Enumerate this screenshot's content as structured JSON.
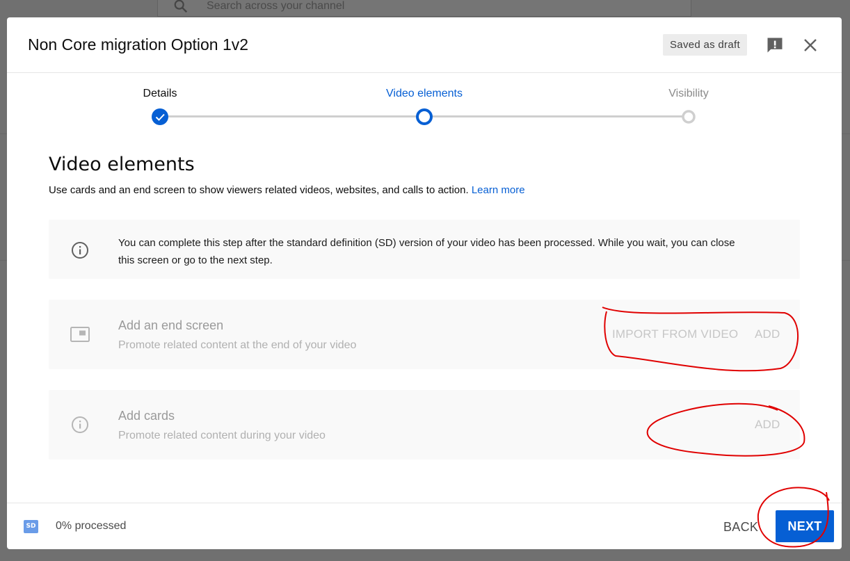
{
  "background": {
    "search_placeholder": "Search across your channel",
    "search_icon": "search-icon"
  },
  "dialog": {
    "title": "Non Core migration Option 1v2",
    "draft_badge": "Saved as draft",
    "feedback_icon": "feedback-icon",
    "close_icon": "close-icon"
  },
  "stepper": {
    "steps": [
      {
        "label": "Details",
        "state": "done"
      },
      {
        "label": "Video elements",
        "state": "active"
      },
      {
        "label": "Visibility",
        "state": "todo"
      }
    ],
    "active_color": "#065fd4"
  },
  "content": {
    "title": "Video elements",
    "description": "Use cards and an end screen to show viewers related videos, websites, and calls to action.",
    "learn_more": "Learn more",
    "info_message": "You can complete this step after the standard definition (SD) version of your video has been processed. While you wait, you can close this screen or go to the next step.",
    "end_screen": {
      "title": "Add an end screen",
      "subtitle": "Promote related content at the end of your video",
      "import_label": "IMPORT FROM VIDEO",
      "add_label": "ADD",
      "icon": "end-screen-icon"
    },
    "cards": {
      "title": "Add cards",
      "subtitle": "Promote related content during your video",
      "add_label": "ADD",
      "icon": "info-icon"
    }
  },
  "footer": {
    "sd_badge": "SD",
    "processed": "0% processed",
    "back_label": "BACK",
    "next_label": "NEXT"
  },
  "colors": {
    "accent": "#065fd4",
    "annotation": "#e00000"
  }
}
